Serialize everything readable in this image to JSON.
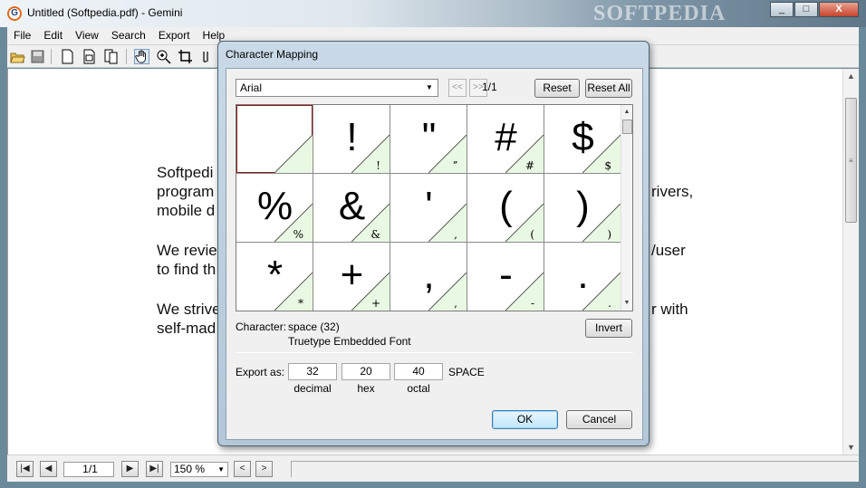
{
  "window": {
    "title": "Untitled (Softpedia.pdf) - Gemini",
    "watermark": "SOFTPEDIA",
    "controls": [
      "_",
      "□",
      "X"
    ]
  },
  "menu": [
    "File",
    "Edit",
    "View",
    "Search",
    "Export",
    "Help"
  ],
  "toolbar": {
    "icons": [
      "open-folder-icon",
      "save-icon",
      "new-page-icon",
      "page-icon",
      "multi-page-icon",
      "hand-icon",
      "zoom-in-icon",
      "crop-icon",
      "text-select-icon"
    ]
  },
  "document": {
    "paragraphs": [
      [
        "Softpedi",
        "program",
        "mobile d"
      ],
      [
        "We revie",
        "to find th"
      ],
      [
        "We strive",
        "self-mad"
      ]
    ],
    "right_fragments": [
      "rivers,",
      "/user",
      "r with"
    ]
  },
  "statusbar": {
    "page": "1/1",
    "zoom": "150 %"
  },
  "dialog": {
    "title": "Character Mapping",
    "font": "Arial",
    "prev": "<<",
    "next": ">>",
    "page": "1/1",
    "reset": "Reset",
    "reset_all": "Reset All",
    "glyphs": [
      {
        "big": "",
        "small": ""
      },
      {
        "big": "!",
        "small": "!"
      },
      {
        "big": "\"",
        "small": "ˮ"
      },
      {
        "big": "#",
        "small": "#"
      },
      {
        "big": "$",
        "small": "$"
      },
      {
        "big": "%",
        "small": "%"
      },
      {
        "big": "&",
        "small": "&"
      },
      {
        "big": "'",
        "small": ","
      },
      {
        "big": "(",
        "small": "("
      },
      {
        "big": ")",
        "small": ")"
      },
      {
        "big": "*",
        "small": "*"
      },
      {
        "big": "+",
        "small": "+"
      },
      {
        "big": ",",
        "small": ","
      },
      {
        "big": "-",
        "small": "-"
      },
      {
        "big": ".",
        "small": "."
      }
    ],
    "character_label": "Character:",
    "character_value": "space (32)",
    "font_info": "Truetype Embedded Font",
    "invert": "Invert",
    "export_label": "Export as:",
    "export": [
      {
        "value": "32",
        "label": "decimal"
      },
      {
        "value": "20",
        "label": "hex"
      },
      {
        "value": "40",
        "label": "octal"
      }
    ],
    "export_name": "SPACE",
    "ok": "OK",
    "cancel": "Cancel"
  }
}
